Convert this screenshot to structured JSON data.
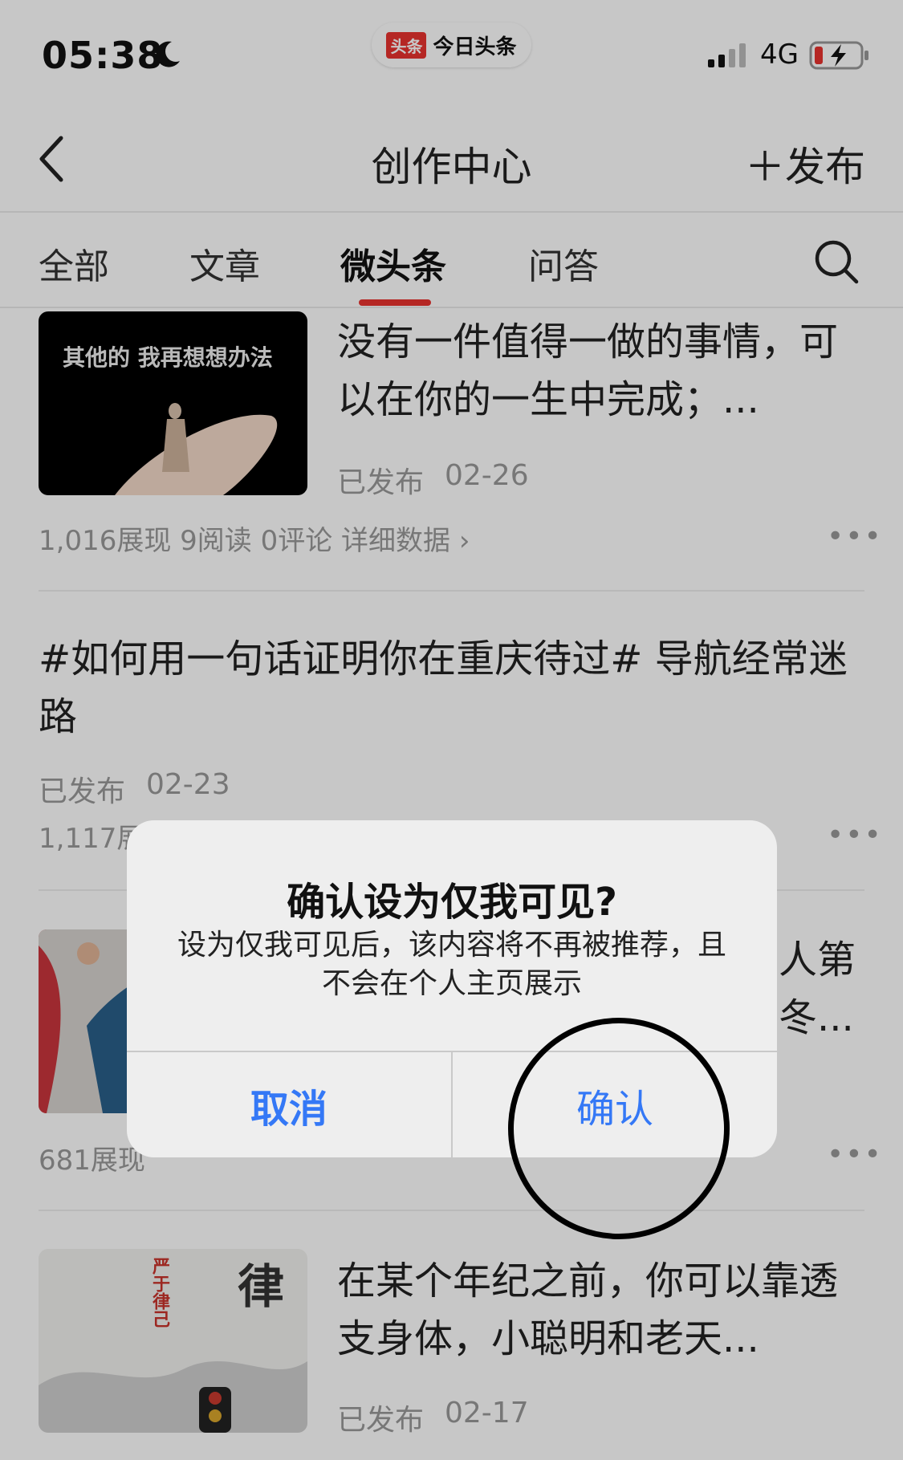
{
  "status_bar": {
    "time": "05:38",
    "app_pill_logo": "头条",
    "app_pill_name": "今日头条",
    "network": "4G",
    "icons": [
      "moon-icon",
      "signal-icon",
      "battery-charging-icon"
    ]
  },
  "header": {
    "back_icon": "chevron-left-icon",
    "title": "创作中心",
    "publish_label": "＋发布"
  },
  "tabs": [
    {
      "label": "全部",
      "active": false
    },
    {
      "label": "文章",
      "active": false
    },
    {
      "label": "微头条",
      "active": true
    },
    {
      "label": "问答",
      "active": false
    }
  ],
  "search_icon": "search-icon",
  "feed": [
    {
      "thumbnail_text": "其他的  我再想想办法",
      "title": "没有一件值得一做的事情，可以在你的一生中完成；...",
      "status": "已发布",
      "date": "02-26",
      "stats": "1,016展现   9阅读   0评论   详细数据 ›"
    },
    {
      "title": "#如何用一句话证明你在重庆待过# 导航经常迷路",
      "status": "已发布",
      "date": "02-23",
      "stats": "1,117展现"
    },
    {
      "title_partial_1": "人第",
      "title_partial_2": "冬...",
      "stats": "681展现"
    },
    {
      "title": "在某个年纪之前，你可以靠透支身体，小聪明和老天...",
      "status": "已发布",
      "date": "02-17",
      "thumbnail_text_1": "严于律己",
      "thumbnail_text_2": "律"
    }
  ],
  "more_label": "•••",
  "dialog": {
    "title": "确认设为仅我可见?",
    "message": "设为仅我可见后，该内容将不再被推荐，且不会在个人主页展示",
    "cancel_label": "取消",
    "confirm_label": "确认"
  },
  "colors": {
    "accent_red": "#e8322f",
    "ios_blue": "#3478f6",
    "text_gray": "#999999"
  }
}
